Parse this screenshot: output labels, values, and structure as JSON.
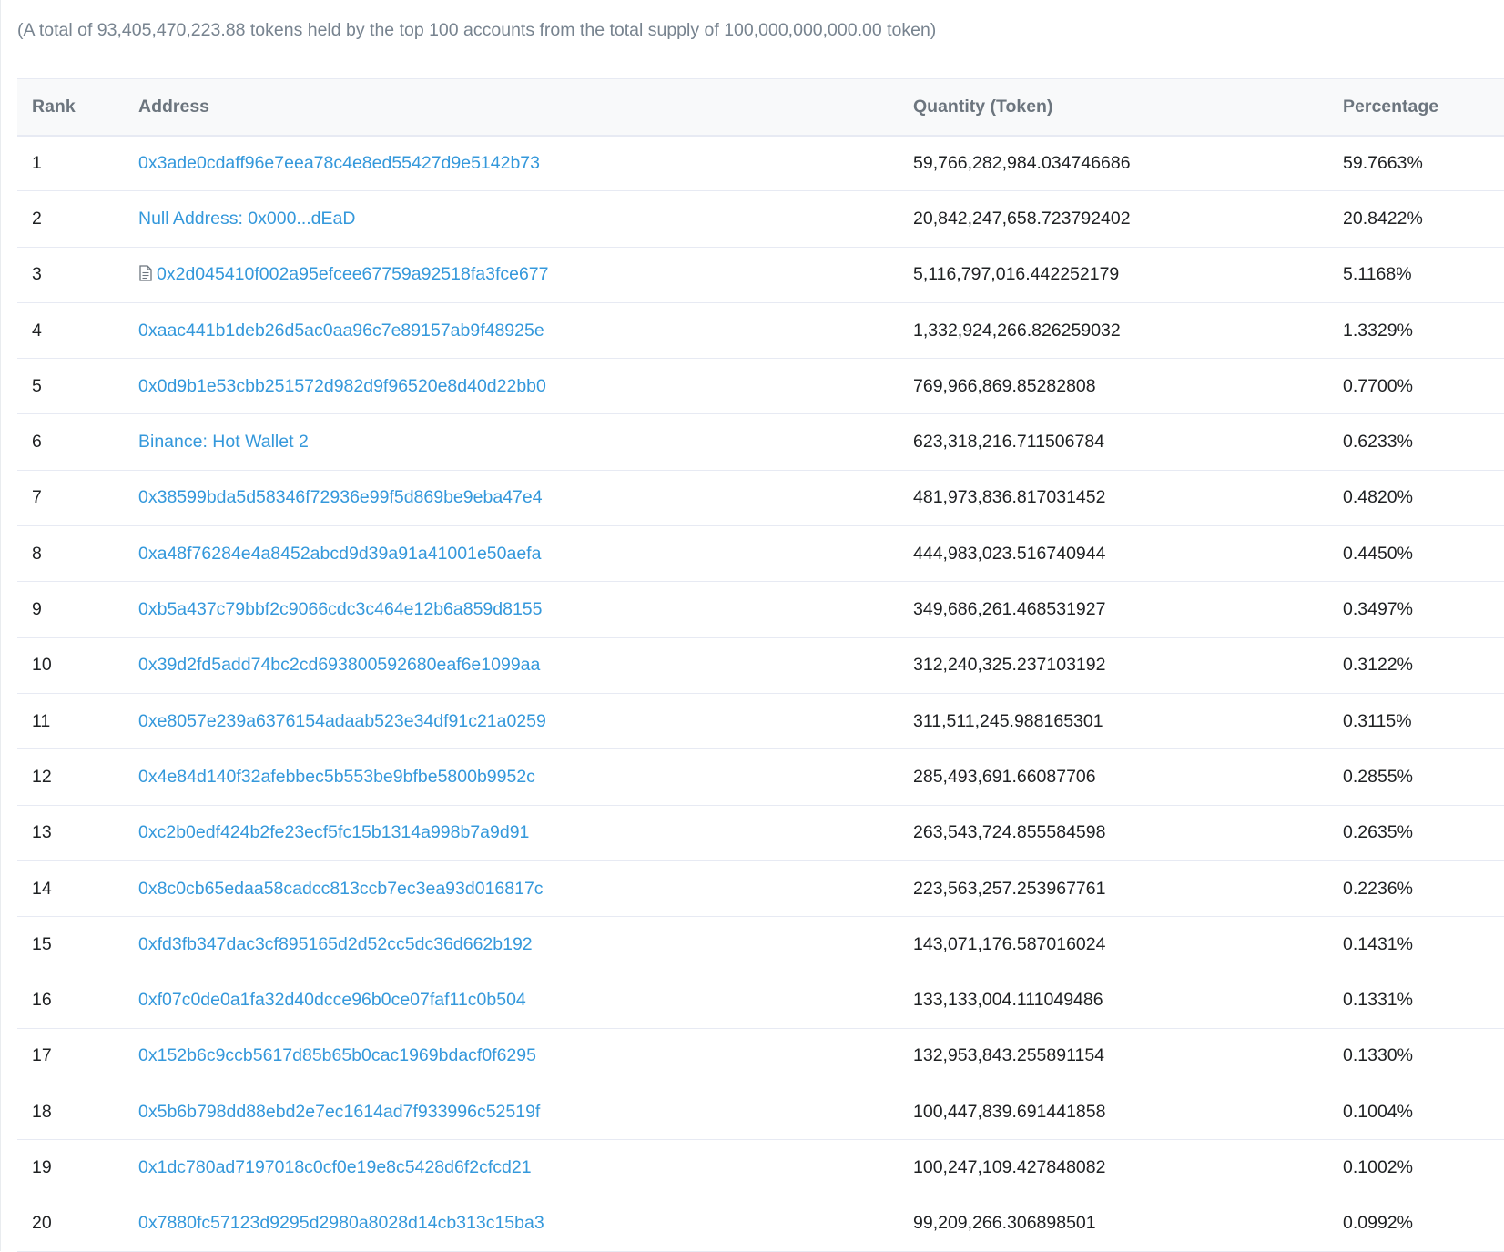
{
  "summary_text": "(A total of 93,405,470,223.88 tokens held by the top 100 accounts from the total supply of 100,000,000,000.00 token)",
  "columns": {
    "rank": "Rank",
    "address": "Address",
    "quantity": "Quantity (Token)",
    "percentage": "Percentage"
  },
  "colors": {
    "link": "#3498db",
    "header_text": "#6c757e",
    "summary_text": "#77838f",
    "border": "#e7eaf3",
    "header_bg": "#f8f9fa"
  },
  "rows": [
    {
      "rank": "1",
      "address": "0x3ade0cdaff96e7eea78c4e8ed55427d9e5142b73",
      "contract": false,
      "quantity": "59,766,282,984.034746686",
      "percentage": "59.7663%"
    },
    {
      "rank": "2",
      "address": "Null Address: 0x000...dEaD",
      "contract": false,
      "quantity": "20,842,247,658.723792402",
      "percentage": "20.8422%"
    },
    {
      "rank": "3",
      "address": "0x2d045410f002a95efcee67759a92518fa3fce677",
      "contract": true,
      "icon": "contract-document-icon",
      "quantity": "5,116,797,016.442252179",
      "percentage": "5.1168%"
    },
    {
      "rank": "4",
      "address": "0xaac441b1deb26d5ac0aa96c7e89157ab9f48925e",
      "contract": false,
      "quantity": "1,332,924,266.826259032",
      "percentage": "1.3329%"
    },
    {
      "rank": "5",
      "address": "0x0d9b1e53cbb251572d982d9f96520e8d40d22bb0",
      "contract": false,
      "quantity": "769,966,869.85282808",
      "percentage": "0.7700%"
    },
    {
      "rank": "6",
      "address": "Binance: Hot Wallet 2",
      "contract": false,
      "quantity": "623,318,216.711506784",
      "percentage": "0.6233%"
    },
    {
      "rank": "7",
      "address": "0x38599bda5d58346f72936e99f5d869be9eba47e4",
      "contract": false,
      "quantity": "481,973,836.817031452",
      "percentage": "0.4820%"
    },
    {
      "rank": "8",
      "address": "0xa48f76284e4a8452abcd9d39a91a41001e50aefa",
      "contract": false,
      "quantity": "444,983,023.516740944",
      "percentage": "0.4450%"
    },
    {
      "rank": "9",
      "address": "0xb5a437c79bbf2c9066cdc3c464e12b6a859d8155",
      "contract": false,
      "quantity": "349,686,261.468531927",
      "percentage": "0.3497%"
    },
    {
      "rank": "10",
      "address": "0x39d2fd5add74bc2cd693800592680eaf6e1099aa",
      "contract": false,
      "quantity": "312,240,325.237103192",
      "percentage": "0.3122%"
    },
    {
      "rank": "11",
      "address": "0xe8057e239a6376154adaab523e34df91c21a0259",
      "contract": false,
      "quantity": "311,511,245.988165301",
      "percentage": "0.3115%"
    },
    {
      "rank": "12",
      "address": "0x4e84d140f32afebbec5b553be9bfbe5800b9952c",
      "contract": false,
      "quantity": "285,493,691.66087706",
      "percentage": "0.2855%"
    },
    {
      "rank": "13",
      "address": "0xc2b0edf424b2fe23ecf5fc15b1314a998b7a9d91",
      "contract": false,
      "quantity": "263,543,724.855584598",
      "percentage": "0.2635%"
    },
    {
      "rank": "14",
      "address": "0x8c0cb65edaa58cadcc813ccb7ec3ea93d016817c",
      "contract": false,
      "quantity": "223,563,257.253967761",
      "percentage": "0.2236%"
    },
    {
      "rank": "15",
      "address": "0xfd3fb347dac3cf895165d2d52cc5dc36d662b192",
      "contract": false,
      "quantity": "143,071,176.587016024",
      "percentage": "0.1431%"
    },
    {
      "rank": "16",
      "address": "0xf07c0de0a1fa32d40dcce96b0ce07faf11c0b504",
      "contract": false,
      "quantity": "133,133,004.111049486",
      "percentage": "0.1331%"
    },
    {
      "rank": "17",
      "address": "0x152b6c9ccb5617d85b65b0cac1969bdacf0f6295",
      "contract": false,
      "quantity": "132,953,843.255891154",
      "percentage": "0.1330%"
    },
    {
      "rank": "18",
      "address": "0x5b6b798dd88ebd2e7ec1614ad7f933996c52519f",
      "contract": false,
      "quantity": "100,447,839.691441858",
      "percentage": "0.1004%"
    },
    {
      "rank": "19",
      "address": "0x1dc780ad7197018c0cf0e19e8c5428d6f2cfcd21",
      "contract": false,
      "quantity": "100,247,109.427848082",
      "percentage": "0.1002%"
    },
    {
      "rank": "20",
      "address": "0x7880fc57123d9295d2980a8028d14cb313c15ba3",
      "contract": false,
      "quantity": "99,209,266.306898501",
      "percentage": "0.0992%"
    }
  ]
}
